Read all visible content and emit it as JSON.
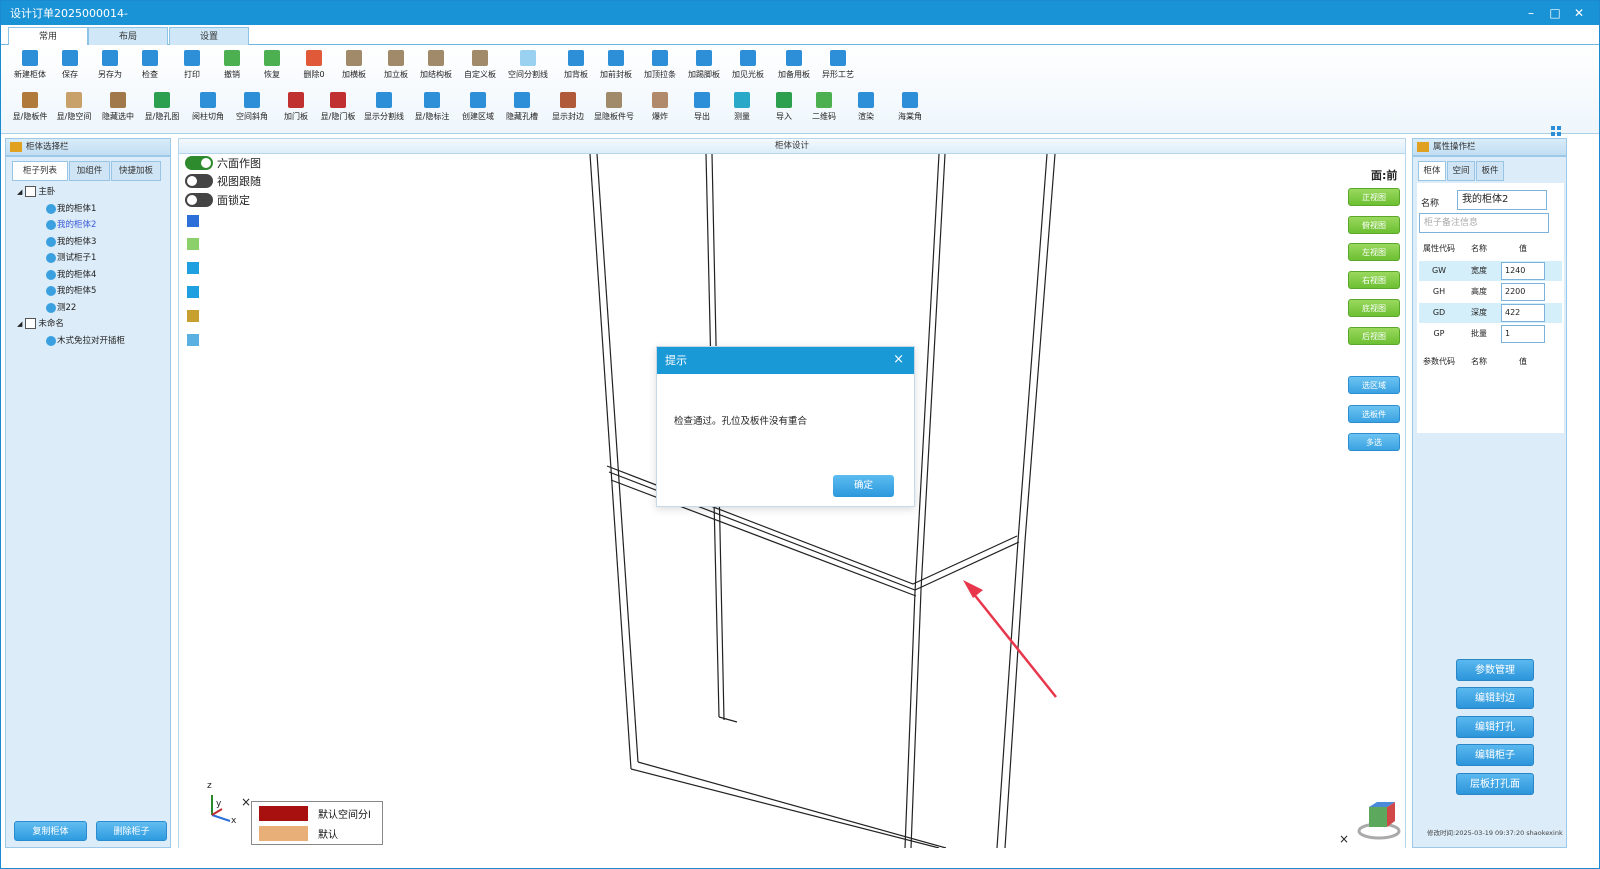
{
  "window": {
    "title": "设计订单2025000014-",
    "controls": [
      "–",
      "□",
      "✕"
    ]
  },
  "ribbon": {
    "tabs": [
      "常用",
      "布局",
      "设置"
    ],
    "active_tab": "常用",
    "row1": [
      {
        "label": "新建柜体",
        "icon": "new-cabinet-icon",
        "color": "#2d8fd8"
      },
      {
        "label": "保存",
        "icon": "save-icon",
        "color": "#2d8fd8"
      },
      {
        "label": "另存为",
        "icon": "save-as-icon",
        "color": "#2d8fd8"
      },
      {
        "label": "检查",
        "icon": "check-icon",
        "color": "#2d8fd8"
      },
      {
        "label": "打印",
        "icon": "print-icon",
        "color": "#2d8fd8"
      },
      {
        "label": "撤销",
        "icon": "undo-icon",
        "color": "#4caf50"
      },
      {
        "label": "恢复",
        "icon": "redo-icon",
        "color": "#4caf50"
      },
      {
        "label": "删除0",
        "icon": "delete-icon",
        "color": "#e05a3a"
      },
      {
        "label": "加横板",
        "icon": "add-horizontal-board-icon",
        "color": "#a08a6a"
      },
      {
        "label": "加立板",
        "icon": "add-vertical-board-icon",
        "color": "#a08a6a"
      },
      {
        "label": "加结构板",
        "icon": "add-structure-board-icon",
        "color": "#a08a6a"
      },
      {
        "label": "自定义板",
        "icon": "custom-board-icon",
        "color": "#a08a6a"
      },
      {
        "label": "空间分割线",
        "icon": "space-divider-icon",
        "color": "#9ad0f0"
      },
      {
        "label": "加背板",
        "icon": "add-back-board-icon",
        "color": "#2d8fd8"
      },
      {
        "label": "加前封板",
        "icon": "add-front-seal-icon",
        "color": "#2d8fd8"
      },
      {
        "label": "加顶拉条",
        "icon": "add-top-strip-icon",
        "color": "#2d8fd8"
      },
      {
        "label": "加踢脚板",
        "icon": "add-kickboard-icon",
        "color": "#2d8fd8"
      },
      {
        "label": "加见光板",
        "icon": "add-visible-board-icon",
        "color": "#2d8fd8"
      },
      {
        "label": "加备用板",
        "icon": "add-spare-board-icon",
        "color": "#2d8fd8"
      },
      {
        "label": "异形工艺",
        "icon": "special-process-icon",
        "color": "#2d8fd8"
      }
    ],
    "row2": [
      {
        "label": "显/隐板件",
        "icon": "toggle-boards-icon",
        "color": "#b07a3a"
      },
      {
        "label": "显/隐空间",
        "icon": "toggle-space-icon",
        "color": "#c8a06a"
      },
      {
        "label": "隐藏选中",
        "icon": "hide-selected-icon",
        "color": "#a0784a"
      },
      {
        "label": "显/隐孔图",
        "icon": "toggle-holes-icon",
        "color": "#2da050"
      },
      {
        "label": "阅柱切角",
        "icon": "column-cut-icon",
        "color": "#2d8fd8"
      },
      {
        "label": "空间斜角",
        "icon": "space-bevel-icon",
        "color": "#2d8fd8"
      },
      {
        "label": "加门板",
        "icon": "add-door-icon",
        "color": "#c03030"
      },
      {
        "label": "显/隐门板",
        "icon": "toggle-door-icon",
        "color": "#c03030"
      },
      {
        "label": "显示分割线",
        "icon": "show-divider-icon",
        "color": "#2d8fd8"
      },
      {
        "label": "显/隐标注",
        "icon": "toggle-dimension-icon",
        "color": "#2d8fd8"
      },
      {
        "label": "创建区域",
        "icon": "create-region-icon",
        "color": "#2d8fd8"
      },
      {
        "label": "隐藏孔槽",
        "icon": "hide-slot-icon",
        "color": "#2d8fd8"
      },
      {
        "label": "显示封边",
        "icon": "show-edge-icon",
        "color": "#b05a3a"
      },
      {
        "label": "显隐板件号",
        "icon": "toggle-board-number-icon",
        "color": "#a08a6a"
      },
      {
        "label": "爆炸",
        "icon": "explode-icon",
        "color": "#b08a6a"
      },
      {
        "label": "导出",
        "icon": "export-icon",
        "color": "#2d8fd8"
      },
      {
        "label": "测量",
        "icon": "measure-icon",
        "color": "#2aa8c8"
      },
      {
        "label": "导入",
        "icon": "import-icon",
        "color": "#2da050"
      },
      {
        "label": "二维码",
        "icon": "qrcode-icon",
        "color": "#4caf50"
      },
      {
        "label": "渲染",
        "icon": "render-icon",
        "color": "#2d8fd8"
      },
      {
        "label": "海棠角",
        "icon": "begonia-corner-icon",
        "color": "#2d8fd8"
      }
    ]
  },
  "left_panel": {
    "title": "柜体选择栏",
    "tabs": [
      "柜子列表",
      "加组件",
      "快捷加板"
    ],
    "tree": [
      {
        "label": "主卧",
        "type": "folder"
      },
      {
        "label": "我的柜体1",
        "type": "item"
      },
      {
        "label": "我的柜体2",
        "type": "item",
        "selected": true
      },
      {
        "label": "我的柜体3",
        "type": "item"
      },
      {
        "label": "测试柜子1",
        "type": "item"
      },
      {
        "label": "我的柜体4",
        "type": "item"
      },
      {
        "label": "我的柜体5",
        "type": "item"
      },
      {
        "label": "测22",
        "type": "item"
      },
      {
        "label": "未命名",
        "type": "folder"
      },
      {
        "label": "木式免拉对开插柜",
        "type": "item"
      }
    ],
    "buttons": [
      "复制柜体",
      "删除柜子"
    ]
  },
  "center": {
    "title": "柜体设计",
    "toggles": [
      {
        "label": "六面作图",
        "on": true
      },
      {
        "label": "视图跟随",
        "on": false
      },
      {
        "label": "面锁定",
        "on": false
      }
    ],
    "face_label": "面:前",
    "view_buttons": [
      "正视图",
      "俯视图",
      "左视图",
      "右视图",
      "底视图",
      "后视图"
    ],
    "select_buttons": [
      "选区域",
      "选板件",
      "多选"
    ],
    "axes": {
      "x": "x",
      "y": "y",
      "z": "z"
    },
    "legend": [
      {
        "label": "默认空间分l",
        "color": "#a80f0f"
      },
      {
        "label": "默认",
        "color": "#e8b078"
      }
    ]
  },
  "dialog": {
    "title": "提示",
    "message": "检查通过。孔位及板件没有重合",
    "ok": "确定"
  },
  "right_panel": {
    "title": "属性操作栏",
    "tabs": [
      "柜体",
      "空间",
      "板件"
    ],
    "name_label": "名称",
    "name_value": "我的柜体2",
    "note_placeholder": "柜子备注信息",
    "attr_header": [
      "属性代码",
      "名称",
      "值"
    ],
    "attrs": [
      {
        "code": "GW",
        "name": "宽度",
        "value": "1240"
      },
      {
        "code": "GH",
        "name": "高度",
        "value": "2200"
      },
      {
        "code": "GD",
        "name": "深度",
        "value": "422"
      },
      {
        "code": "GP",
        "name": "批量",
        "value": "1"
      }
    ],
    "param_header": [
      "参数代码",
      "名称",
      "值"
    ],
    "buttons": [
      "参数管理",
      "编辑封边",
      "编辑打孔",
      "编辑柜子",
      "层板打孔面"
    ],
    "footer": "修改时间:2025-03-19 09:37:20 shaokexink"
  }
}
